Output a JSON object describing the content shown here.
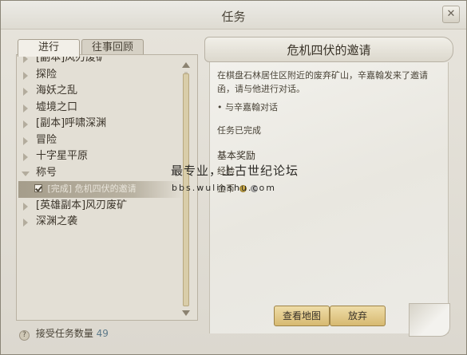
{
  "window": {
    "title": "任务",
    "close_label": "✕"
  },
  "tabs": [
    {
      "label": "进行"
    },
    {
      "label": "往事回顾"
    }
  ],
  "quest_list": [
    {
      "label": "[副本]风刃废矿",
      "state": "collapsed",
      "partial": true
    },
    {
      "label": "探险",
      "state": "collapsed"
    },
    {
      "label": "海妖之乱",
      "state": "collapsed"
    },
    {
      "label": "墟境之口",
      "state": "collapsed"
    },
    {
      "label": "[副本]呼啸深渊",
      "state": "collapsed"
    },
    {
      "label": "冒险",
      "state": "collapsed"
    },
    {
      "label": "十字星平原",
      "state": "collapsed"
    },
    {
      "label": "称号",
      "state": "expanded"
    },
    {
      "label": "[完成] 危机四伏的邀请",
      "state": "selected"
    },
    {
      "label": "[英雄副本]风刃废矿",
      "state": "collapsed"
    },
    {
      "label": "深渊之袭",
      "state": "collapsed"
    }
  ],
  "footer": {
    "label": "接受任务数量",
    "count": "49"
  },
  "detail": {
    "title": "危机四伏的邀请",
    "description": "在棋盘石林居住区附近的废弃矿山，辛嘉翰发来了邀请函，请与他进行对话。",
    "objective": "与辛嘉翰对话",
    "status": "任务已完成",
    "reward_title": "基本奖励",
    "reward_line1": "经验",
    "reward_line2": "金币"
  },
  "watermark": {
    "line1": "最专业，上古世纪论坛",
    "line2": "bbs.wulinshu.com"
  },
  "buttons": {
    "map": "查看地图",
    "abandon": "放弃"
  }
}
